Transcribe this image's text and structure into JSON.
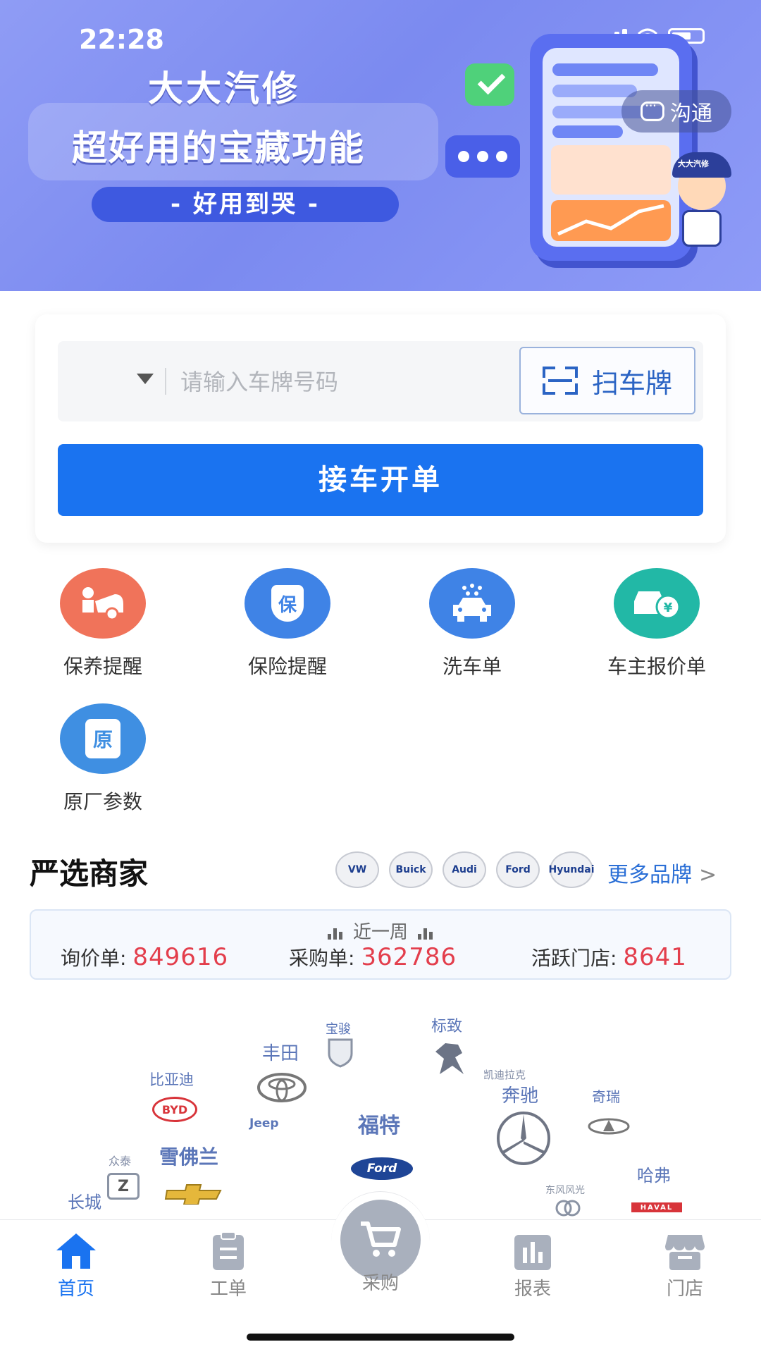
{
  "status_bar": {
    "time": "22:28"
  },
  "banner": {
    "title": "大大汽修",
    "slogan": "超好用的宝藏功能",
    "pill": "- 好用到哭 -",
    "mascot_cap": "大大汽修",
    "chat_label": "沟通"
  },
  "search": {
    "placeholder": "请输入车牌号码",
    "value": "",
    "scan_label": "扫车牌",
    "open_order_label": "接车开单"
  },
  "features": [
    {
      "label": "保养提醒",
      "icon": "car-maintenance-icon",
      "color": "#f0735a"
    },
    {
      "label": "保险提醒",
      "icon": "insurance-shield-icon",
      "color": "#3f83e6",
      "glyph": "保"
    },
    {
      "label": "洗车单",
      "icon": "car-wash-icon",
      "color": "#3f83e6"
    },
    {
      "label": "车主报价单",
      "icon": "car-quote-icon",
      "color": "#22b8a6"
    },
    {
      "label": "原厂参数",
      "icon": "oem-params-icon",
      "color": "#3f8fe2",
      "glyph": "原"
    }
  ],
  "merchants": {
    "title": "严选商家",
    "brand_logos": [
      "VW",
      "Buick",
      "Audi",
      "Ford",
      "Hyundai"
    ],
    "more_label": "更多品牌",
    "period": "近一周",
    "stats": [
      {
        "label": "询价单:",
        "value": "849616"
      },
      {
        "label": "采购单:",
        "value": "362786"
      },
      {
        "label": "活跃门店:",
        "value": "8641"
      }
    ],
    "cloud": {
      "baojun": "宝骏",
      "biaozhi": "标致",
      "fengtian": "丰田",
      "biyadi": "比亚迪",
      "byd_logo": "BYD",
      "kaidilake": "凯迪拉克",
      "benchi": "奔驰",
      "qirui": "奇瑞",
      "jeep": "Jeep",
      "fute": "福特",
      "ford_logo": "Ford",
      "zhongtai": "众泰",
      "xuefolan": "雪佛兰",
      "changcheng": "长城",
      "dongfeng": "东风风光",
      "hafu": "哈弗",
      "haval_logo": "HAVAL"
    }
  },
  "tabbar": {
    "tabs": [
      {
        "label": "首页",
        "icon": "home-icon",
        "active": true
      },
      {
        "label": "工单",
        "icon": "clipboard-icon",
        "active": false
      },
      {
        "label": "采购",
        "icon": "cart-icon",
        "active": false
      },
      {
        "label": "报表",
        "icon": "bar-chart-icon",
        "active": false
      },
      {
        "label": "门店",
        "icon": "store-icon",
        "active": false
      }
    ]
  },
  "colors": {
    "primary": "#1a73f0",
    "stat_value": "#e33e4c",
    "link": "#2b6fd6"
  }
}
